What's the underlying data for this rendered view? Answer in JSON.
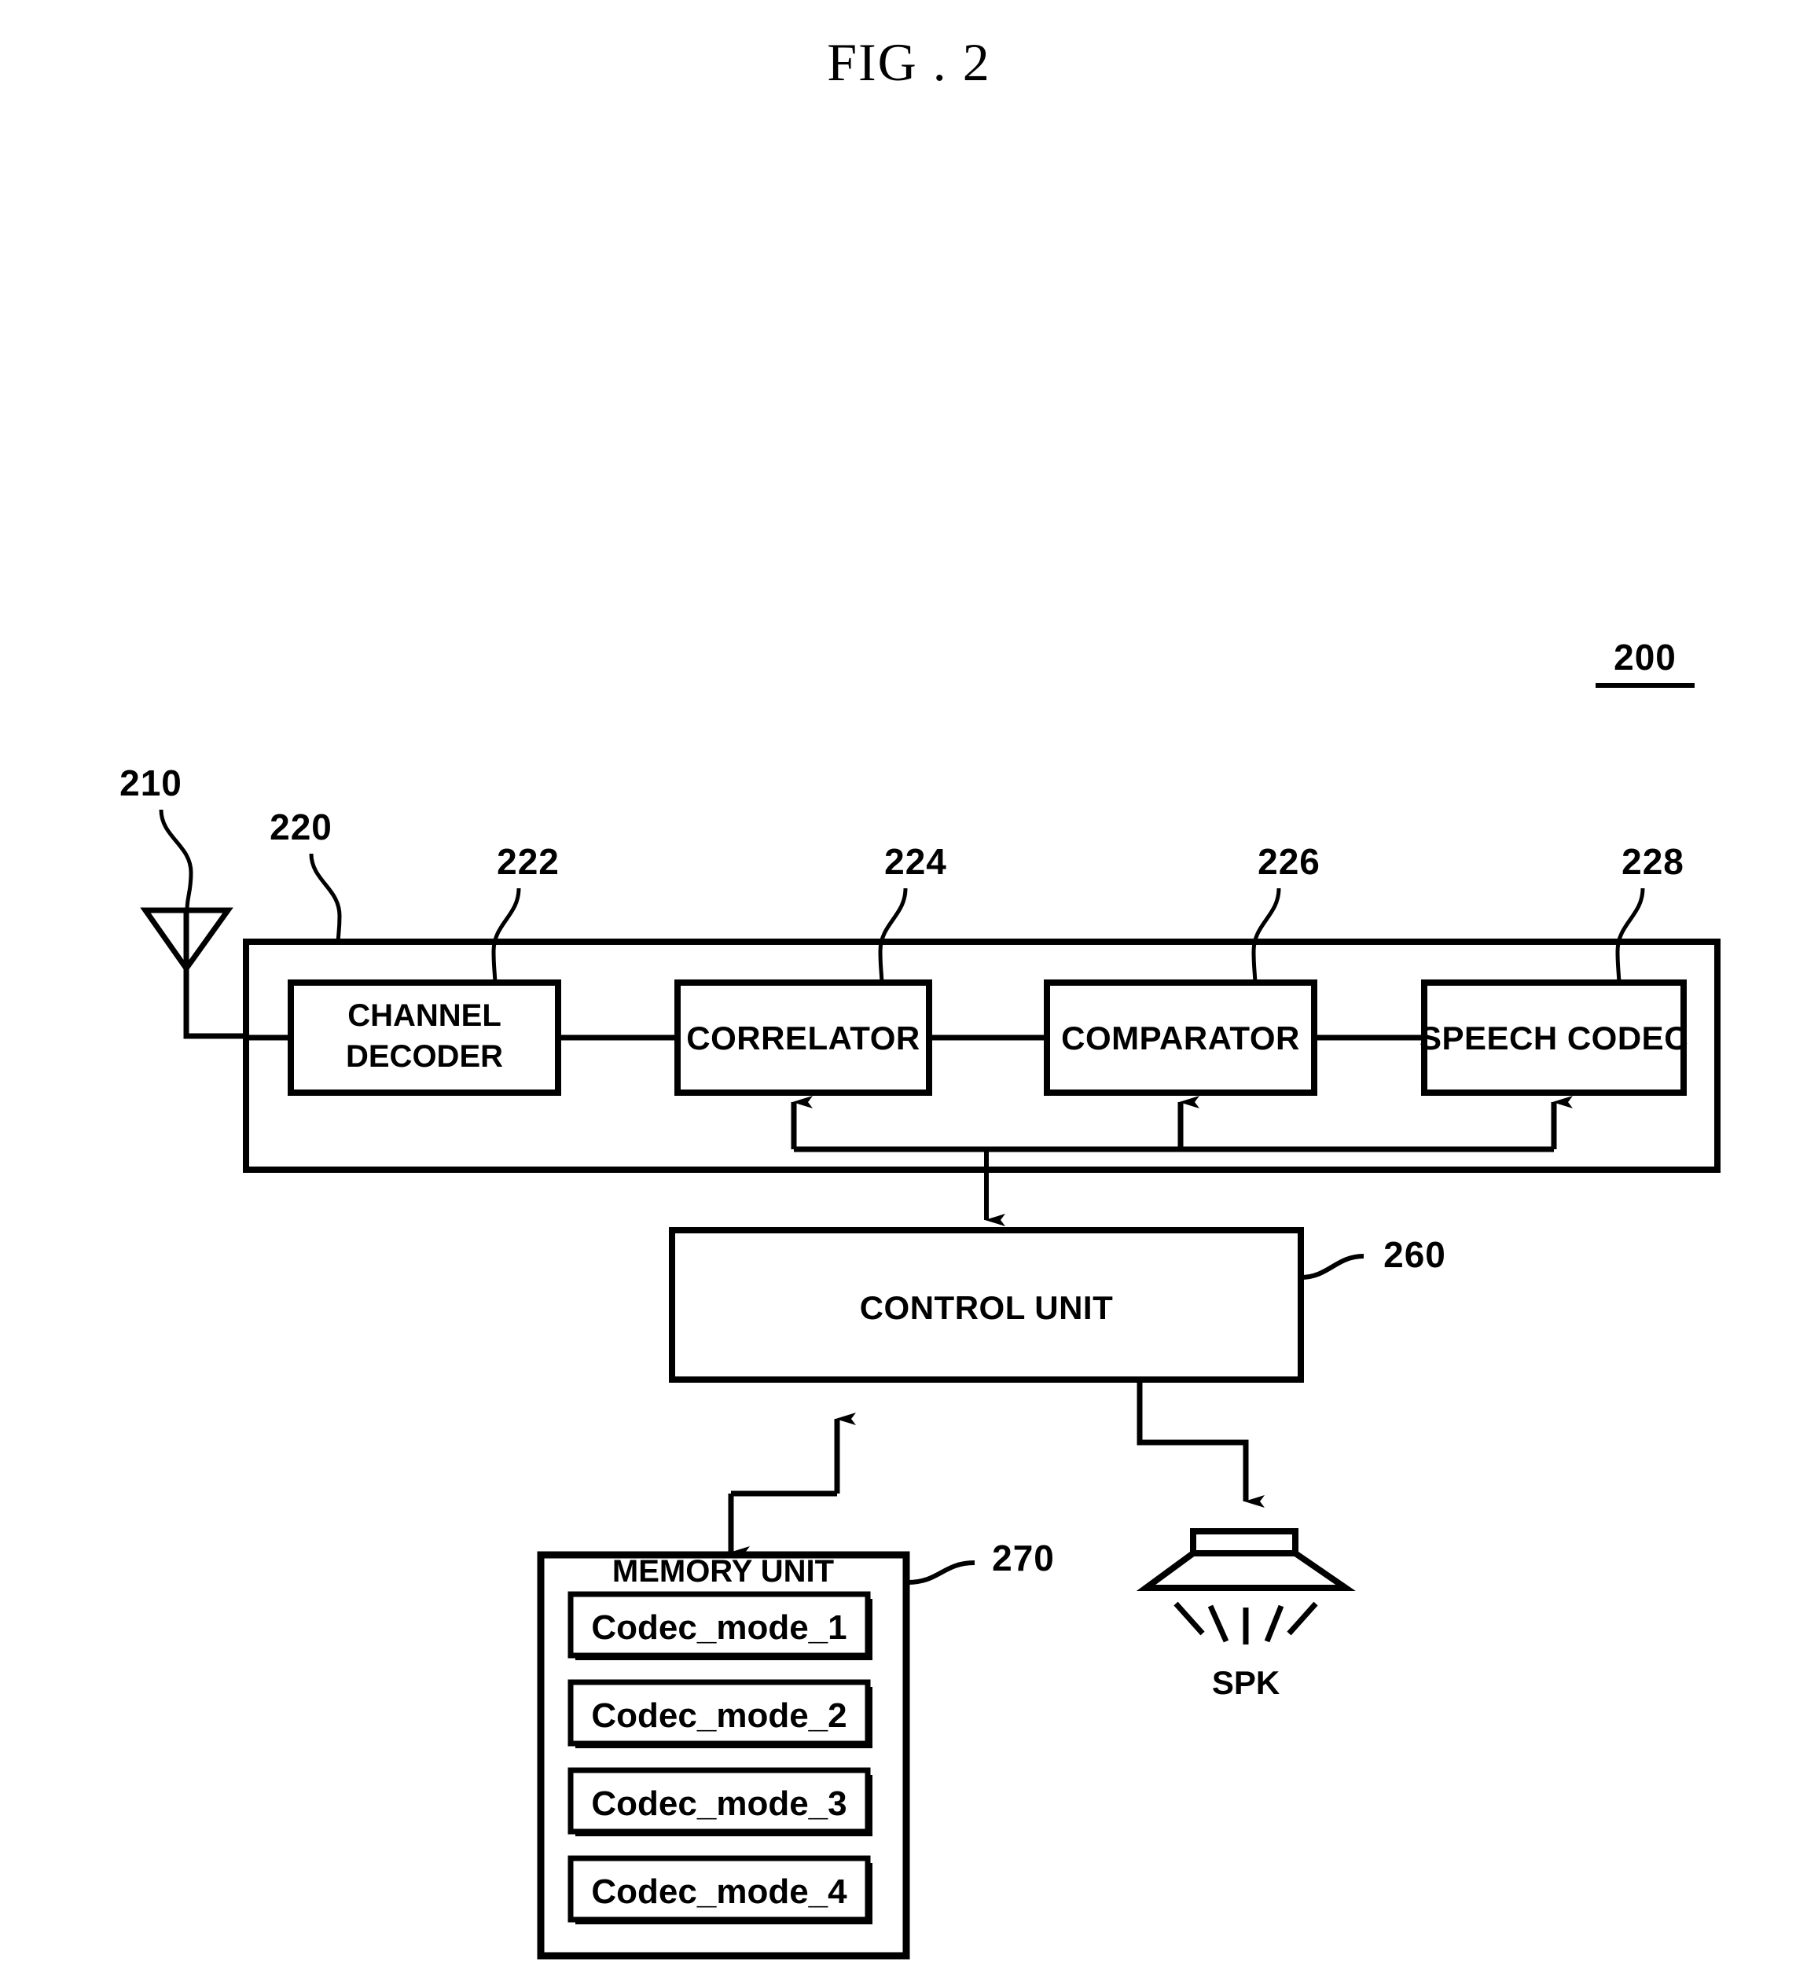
{
  "figure": {
    "title": "FIG . 2",
    "system_ref": "200"
  },
  "blocks": [
    {
      "id": "antenna",
      "name": "antenna",
      "ref": "210",
      "label": ""
    },
    {
      "id": "receiver",
      "name": "receiver-unit",
      "ref": "220",
      "label": ""
    },
    {
      "id": "channel_decoder",
      "name": "channel-decoder",
      "ref": "222",
      "label_line1": "CHANNEL",
      "label_line2": "DECODER"
    },
    {
      "id": "correlator",
      "name": "correlator",
      "ref": "224",
      "label": "CORRELATOR"
    },
    {
      "id": "comparator",
      "name": "comparator",
      "ref": "226",
      "label": "COMPARATOR"
    },
    {
      "id": "speech_codec",
      "name": "speech-codec",
      "ref": "228",
      "label": "SPEECH CODEC"
    },
    {
      "id": "control_unit",
      "name": "control-unit",
      "ref": "260",
      "label": "CONTROL UNIT"
    },
    {
      "id": "memory_unit",
      "name": "memory-unit",
      "ref": "270",
      "label": "MEMORY UNIT"
    },
    {
      "id": "speaker",
      "name": "speaker",
      "ref": "",
      "label": "SPK"
    }
  ],
  "memory": {
    "title": "MEMORY UNIT",
    "ref": "270",
    "entries": [
      "Codec_mode_1",
      "Codec_mode_2",
      "Codec_mode_3",
      "Codec_mode_4"
    ]
  },
  "speaker": {
    "label": "SPK"
  },
  "labels": {
    "channel_decoder_l1": "CHANNEL",
    "channel_decoder_l2": "DECODER",
    "correlator": "CORRELATOR",
    "comparator": "COMPARATOR",
    "speech_codec": "SPEECH CODEC",
    "control_unit": "CONTROL UNIT"
  },
  "refs": {
    "r200": "200",
    "r210": "210",
    "r220": "220",
    "r222": "222",
    "r224": "224",
    "r226": "226",
    "r228": "228",
    "r260": "260",
    "r270": "270"
  },
  "colors": {
    "ink": "#000000",
    "paper": "#ffffff"
  }
}
